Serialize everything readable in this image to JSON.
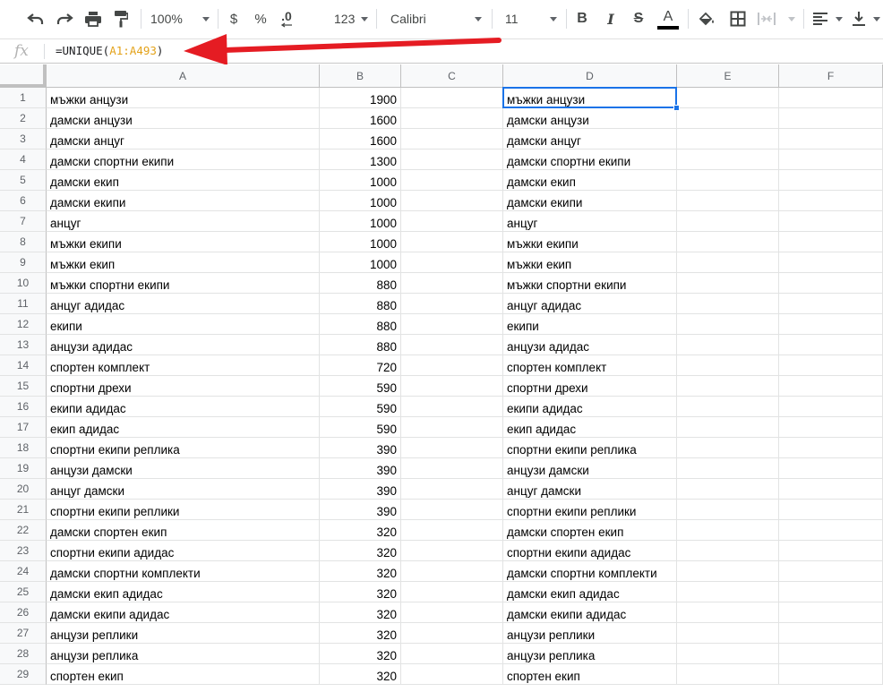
{
  "toolbar": {
    "zoom": "100%",
    "currency": "$",
    "percent": "%",
    "decimal_decrease": ".0",
    "number_format": "123",
    "font": "Calibri",
    "font_size": "11",
    "bold": "B",
    "italic": "I",
    "strike": "S",
    "text_color": "A",
    "text_color_hex": "#000000"
  },
  "formula_bar": {
    "fx_label": "fx",
    "formula_prefix": "=UNIQUE(",
    "formula_ref": "A1:A493",
    "formula_suffix": ")",
    "annotation_arrow_color": "#e51c23"
  },
  "columns": [
    "A",
    "B",
    "C",
    "D",
    "E",
    "F"
  ],
  "rows": [
    {
      "n": "1",
      "a": "мъжки анцузи",
      "b": "1900",
      "d": "мъжки анцузи"
    },
    {
      "n": "2",
      "a": "дамски анцузи",
      "b": "1600",
      "d": "дамски анцузи"
    },
    {
      "n": "3",
      "a": "дамски анцуг",
      "b": "1600",
      "d": "дамски анцуг"
    },
    {
      "n": "4",
      "a": "дамски спортни екипи",
      "b": "1300",
      "d": "дамски спортни екипи"
    },
    {
      "n": "5",
      "a": "дамски екип",
      "b": "1000",
      "d": "дамски екип"
    },
    {
      "n": "6",
      "a": "дамски екипи",
      "b": "1000",
      "d": "дамски екипи"
    },
    {
      "n": "7",
      "a": "анцуг",
      "b": "1000",
      "d": "анцуг"
    },
    {
      "n": "8",
      "a": "мъжки екипи",
      "b": "1000",
      "d": "мъжки екипи"
    },
    {
      "n": "9",
      "a": "мъжки екип",
      "b": "1000",
      "d": "мъжки екип"
    },
    {
      "n": "10",
      "a": "мъжки спортни екипи",
      "b": "880",
      "d": "мъжки спортни екипи"
    },
    {
      "n": "11",
      "a": "анцуг адидас",
      "b": "880",
      "d": "анцуг адидас"
    },
    {
      "n": "12",
      "a": "екипи",
      "b": "880",
      "d": "екипи"
    },
    {
      "n": "13",
      "a": "анцузи адидас",
      "b": "880",
      "d": "анцузи адидас"
    },
    {
      "n": "14",
      "a": "спортен комплект",
      "b": "720",
      "d": "спортен комплект"
    },
    {
      "n": "15",
      "a": "спортни дрехи",
      "b": "590",
      "d": "спортни дрехи"
    },
    {
      "n": "16",
      "a": "екипи адидас",
      "b": "590",
      "d": "екипи адидас"
    },
    {
      "n": "17",
      "a": "екип адидас",
      "b": "590",
      "d": "екип адидас"
    },
    {
      "n": "18",
      "a": "спортни екипи реплика",
      "b": "390",
      "d": "спортни екипи реплика"
    },
    {
      "n": "19",
      "a": "анцузи дамски",
      "b": "390",
      "d": "анцузи дамски"
    },
    {
      "n": "20",
      "a": "анцуг дамски",
      "b": "390",
      "d": "анцуг дамски"
    },
    {
      "n": "21",
      "a": "спортни екипи реплики",
      "b": "390",
      "d": "спортни екипи реплики"
    },
    {
      "n": "22",
      "a": "дамски спортен екип",
      "b": "320",
      "d": "дамски спортен екип"
    },
    {
      "n": "23",
      "a": "спортни екипи адидас",
      "b": "320",
      "d": "спортни екипи адидас"
    },
    {
      "n": "24",
      "a": "дамски спортни комплекти",
      "b": "320",
      "d": "дамски спортни комплекти"
    },
    {
      "n": "25",
      "a": "дамски екип адидас",
      "b": "320",
      "d": "дамски екип адидас"
    },
    {
      "n": "26",
      "a": "дамски екипи адидас",
      "b": "320",
      "d": "дамски екипи адидас"
    },
    {
      "n": "27",
      "a": "анцузи реплики",
      "b": "320",
      "d": "анцузи реплики"
    },
    {
      "n": "28",
      "a": "анцузи реплика",
      "b": "320",
      "d": "анцузи реплика"
    },
    {
      "n": "29",
      "a": "спортен екип",
      "b": "320",
      "d": "спортен екип"
    }
  ]
}
